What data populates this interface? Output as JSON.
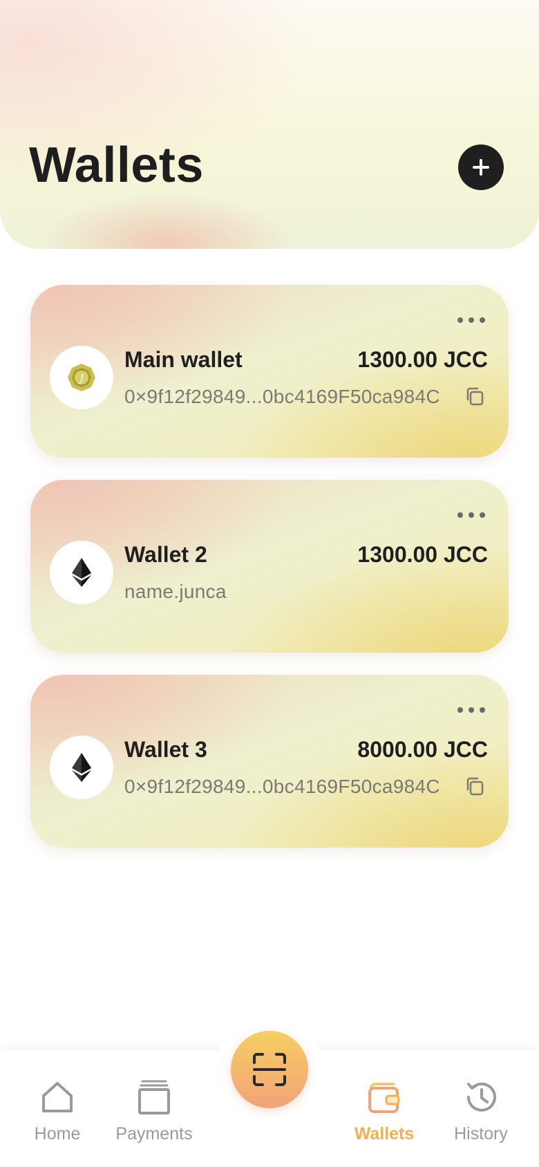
{
  "header": {
    "title": "Wallets",
    "add_button_icon": "plus-icon"
  },
  "wallets": [
    {
      "name": "Main wallet",
      "balance": "1300.00 JCC",
      "address": "0×9f12f29849...0bc4169F50ca984C",
      "avatar_icon": "jcc-coin-icon",
      "has_copy": true
    },
    {
      "name": "Wallet 2",
      "balance": "1300.00 JCC",
      "address": "name.junca",
      "avatar_icon": "ethereum-icon",
      "has_copy": false
    },
    {
      "name": "Wallet 3",
      "balance": "8000.00 JCC",
      "address": "0×9f12f29849...0bc4169F50ca984C",
      "avatar_icon": "ethereum-icon",
      "has_copy": true
    }
  ],
  "nav": {
    "items": [
      {
        "label": "Home",
        "icon": "home-icon",
        "active": false
      },
      {
        "label": "Payments",
        "icon": "payments-icon",
        "active": false
      },
      {
        "label": "Wallets",
        "icon": "wallet-icon",
        "active": true
      },
      {
        "label": "History",
        "icon": "history-icon",
        "active": false
      }
    ],
    "scan_icon": "scan-icon"
  },
  "colors": {
    "accent": "#f2b04e",
    "dark": "#1f1f1f",
    "muted_text": "#7a7a72"
  }
}
